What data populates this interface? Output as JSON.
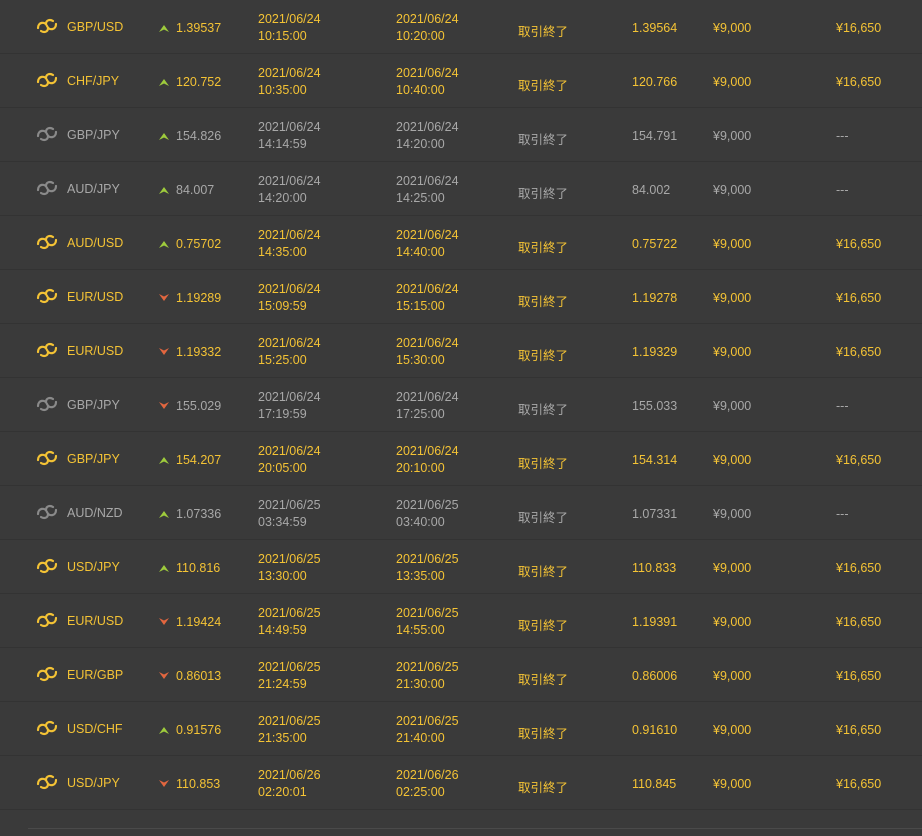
{
  "colors": {
    "win": "#f4c335",
    "lose": "#a8a8a8",
    "up_arrow": "#9ecb3c",
    "down_arrow": "#e2663f",
    "icon_win": "#f4c335",
    "icon_lose": "#8a8a8a"
  },
  "trades": [
    {
      "pair": "GBP/USD",
      "direction": "up",
      "entry_rate": "1.39537",
      "entry_date": "2021/06/24",
      "entry_time": "10:15:00",
      "exit_date": "2021/06/24",
      "exit_time": "10:20:00",
      "status": "取引終了",
      "exit_rate": "1.39564",
      "amount": "¥9,000",
      "payout": "¥16,650",
      "result": "win"
    },
    {
      "pair": "CHF/JPY",
      "direction": "up",
      "entry_rate": "120.752",
      "entry_date": "2021/06/24",
      "entry_time": "10:35:00",
      "exit_date": "2021/06/24",
      "exit_time": "10:40:00",
      "status": "取引終了",
      "exit_rate": "120.766",
      "amount": "¥9,000",
      "payout": "¥16,650",
      "result": "win"
    },
    {
      "pair": "GBP/JPY",
      "direction": "up",
      "entry_rate": "154.826",
      "entry_date": "2021/06/24",
      "entry_time": "14:14:59",
      "exit_date": "2021/06/24",
      "exit_time": "14:20:00",
      "status": "取引終了",
      "exit_rate": "154.791",
      "amount": "¥9,000",
      "payout": "---",
      "result": "lose"
    },
    {
      "pair": "AUD/JPY",
      "direction": "up",
      "entry_rate": "84.007",
      "entry_date": "2021/06/24",
      "entry_time": "14:20:00",
      "exit_date": "2021/06/24",
      "exit_time": "14:25:00",
      "status": "取引終了",
      "exit_rate": "84.002",
      "amount": "¥9,000",
      "payout": "---",
      "result": "lose"
    },
    {
      "pair": "AUD/USD",
      "direction": "up",
      "entry_rate": "0.75702",
      "entry_date": "2021/06/24",
      "entry_time": "14:35:00",
      "exit_date": "2021/06/24",
      "exit_time": "14:40:00",
      "status": "取引終了",
      "exit_rate": "0.75722",
      "amount": "¥9,000",
      "payout": "¥16,650",
      "result": "win"
    },
    {
      "pair": "EUR/USD",
      "direction": "down",
      "entry_rate": "1.19289",
      "entry_date": "2021/06/24",
      "entry_time": "15:09:59",
      "exit_date": "2021/06/24",
      "exit_time": "15:15:00",
      "status": "取引終了",
      "exit_rate": "1.19278",
      "amount": "¥9,000",
      "payout": "¥16,650",
      "result": "win"
    },
    {
      "pair": "EUR/USD",
      "direction": "down",
      "entry_rate": "1.19332",
      "entry_date": "2021/06/24",
      "entry_time": "15:25:00",
      "exit_date": "2021/06/24",
      "exit_time": "15:30:00",
      "status": "取引終了",
      "exit_rate": "1.19329",
      "amount": "¥9,000",
      "payout": "¥16,650",
      "result": "win"
    },
    {
      "pair": "GBP/JPY",
      "direction": "down",
      "entry_rate": "155.029",
      "entry_date": "2021/06/24",
      "entry_time": "17:19:59",
      "exit_date": "2021/06/24",
      "exit_time": "17:25:00",
      "status": "取引終了",
      "exit_rate": "155.033",
      "amount": "¥9,000",
      "payout": "---",
      "result": "lose"
    },
    {
      "pair": "GBP/JPY",
      "direction": "up",
      "entry_rate": "154.207",
      "entry_date": "2021/06/24",
      "entry_time": "20:05:00",
      "exit_date": "2021/06/24",
      "exit_time": "20:10:00",
      "status": "取引終了",
      "exit_rate": "154.314",
      "amount": "¥9,000",
      "payout": "¥16,650",
      "result": "win"
    },
    {
      "pair": "AUD/NZD",
      "direction": "up",
      "entry_rate": "1.07336",
      "entry_date": "2021/06/25",
      "entry_time": "03:34:59",
      "exit_date": "2021/06/25",
      "exit_time": "03:40:00",
      "status": "取引終了",
      "exit_rate": "1.07331",
      "amount": "¥9,000",
      "payout": "---",
      "result": "lose"
    },
    {
      "pair": "USD/JPY",
      "direction": "up",
      "entry_rate": "110.816",
      "entry_date": "2021/06/25",
      "entry_time": "13:30:00",
      "exit_date": "2021/06/25",
      "exit_time": "13:35:00",
      "status": "取引終了",
      "exit_rate": "110.833",
      "amount": "¥9,000",
      "payout": "¥16,650",
      "result": "win"
    },
    {
      "pair": "EUR/USD",
      "direction": "down",
      "entry_rate": "1.19424",
      "entry_date": "2021/06/25",
      "entry_time": "14:49:59",
      "exit_date": "2021/06/25",
      "exit_time": "14:55:00",
      "status": "取引終了",
      "exit_rate": "1.19391",
      "amount": "¥9,000",
      "payout": "¥16,650",
      "result": "win"
    },
    {
      "pair": "EUR/GBP",
      "direction": "down",
      "entry_rate": "0.86013",
      "entry_date": "2021/06/25",
      "entry_time": "21:24:59",
      "exit_date": "2021/06/25",
      "exit_time": "21:30:00",
      "status": "取引終了",
      "exit_rate": "0.86006",
      "amount": "¥9,000",
      "payout": "¥16,650",
      "result": "win"
    },
    {
      "pair": "USD/CHF",
      "direction": "up",
      "entry_rate": "0.91576",
      "entry_date": "2021/06/25",
      "entry_time": "21:35:00",
      "exit_date": "2021/06/25",
      "exit_time": "21:40:00",
      "status": "取引終了",
      "exit_rate": "0.91610",
      "amount": "¥9,000",
      "payout": "¥16,650",
      "result": "win"
    },
    {
      "pair": "USD/JPY",
      "direction": "down",
      "entry_rate": "110.853",
      "entry_date": "2021/06/26",
      "entry_time": "02:20:01",
      "exit_date": "2021/06/26",
      "exit_time": "02:25:00",
      "status": "取引終了",
      "exit_rate": "110.845",
      "amount": "¥9,000",
      "payout": "¥16,650",
      "result": "win"
    }
  ]
}
